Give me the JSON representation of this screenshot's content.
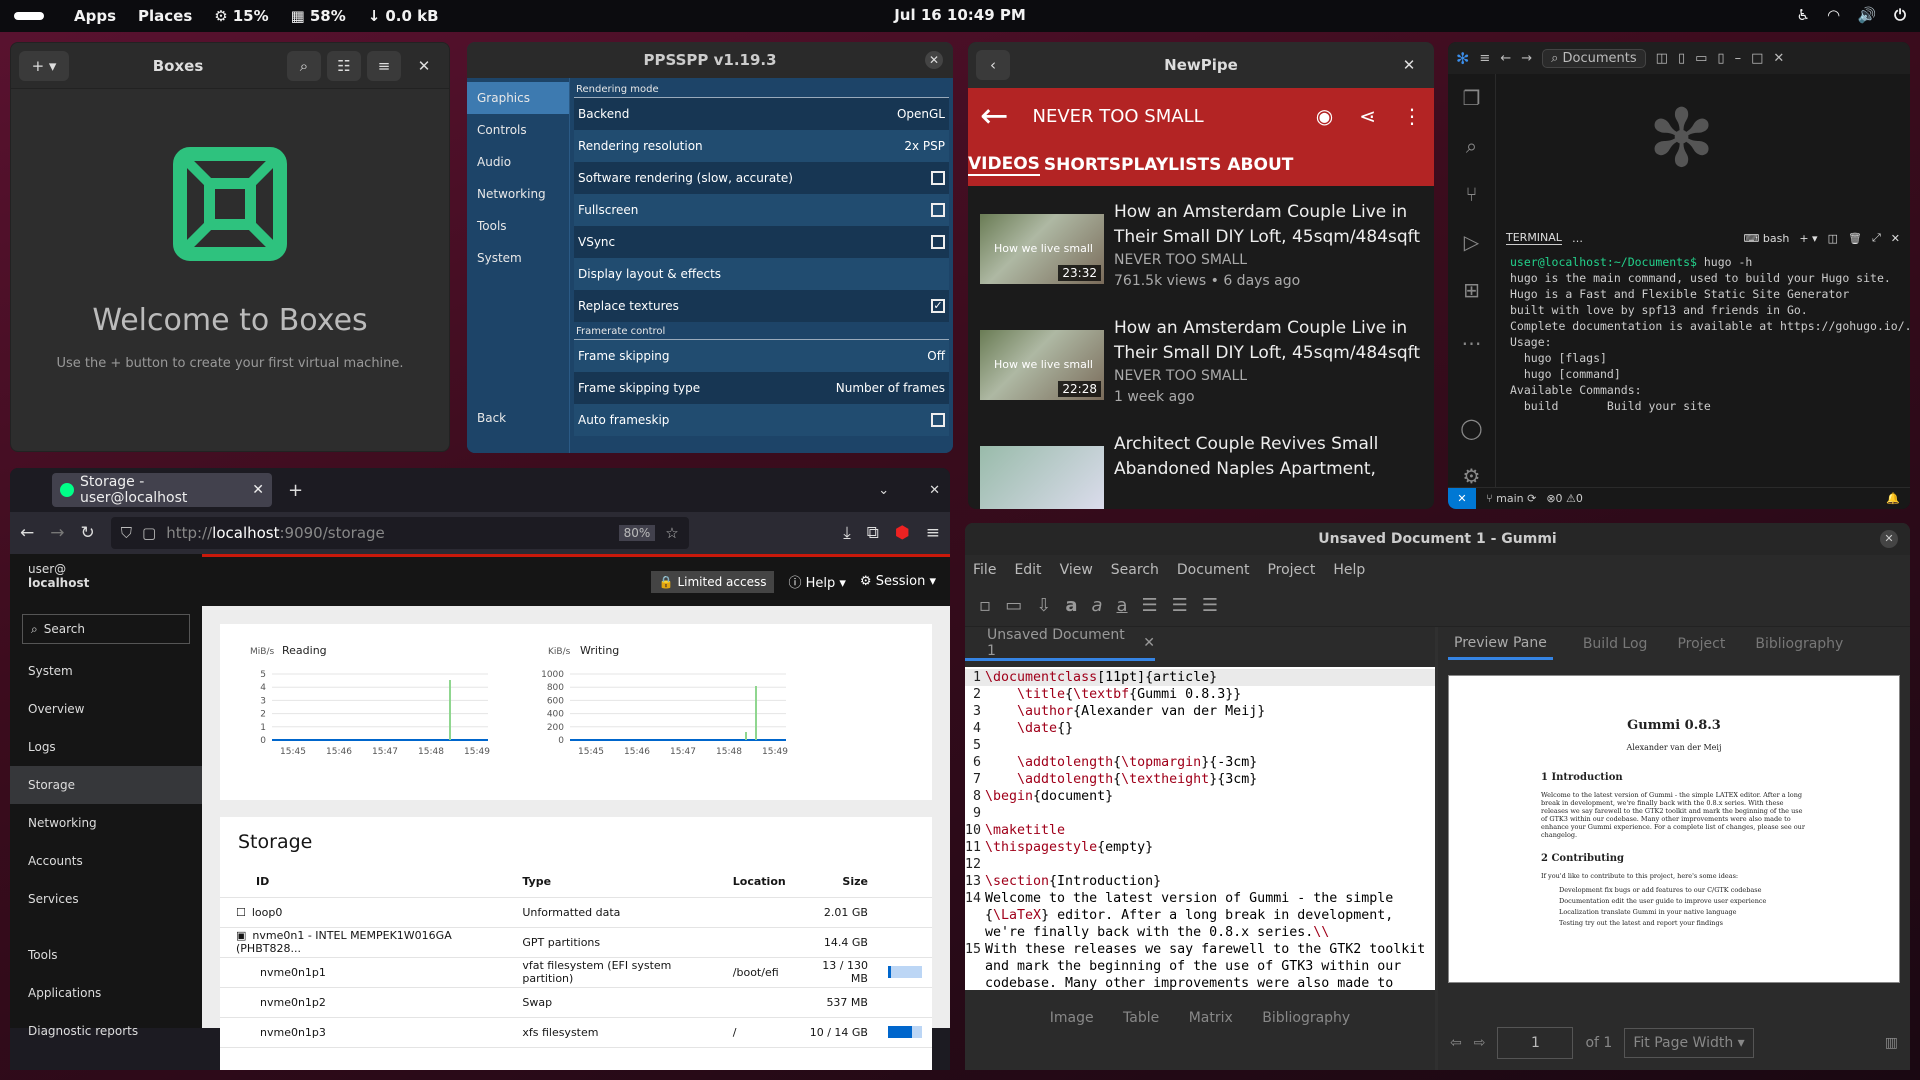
{
  "topbar": {
    "apps": "Apps",
    "places": "Places",
    "cpu": "15%",
    "mem": "58%",
    "net": "0.0 kB",
    "clock": "Jul 16  10:49 PM"
  },
  "boxes": {
    "title": "Boxes",
    "welcome": "Welcome to Boxes",
    "hint": "Use the + button to create your first virtual machine."
  },
  "ppsspp": {
    "title": "PPSSPP v1.19.3",
    "nav": [
      "Graphics",
      "Controls",
      "Audio",
      "Networking",
      "Tools",
      "System"
    ],
    "back": "Back",
    "section1": "Rendering mode",
    "section2": "Framerate control",
    "rows": [
      {
        "label": "Backend",
        "value": "OpenGL"
      },
      {
        "label": "Rendering resolution",
        "value": "2x PSP"
      },
      {
        "label": "Software rendering (slow, accurate)",
        "value": ""
      },
      {
        "label": "Fullscreen",
        "value": ""
      },
      {
        "label": "VSync",
        "value": ""
      },
      {
        "label": "Display layout & effects",
        "value": ""
      },
      {
        "label": "Replace textures",
        "value": ""
      }
    ],
    "rows2": [
      {
        "label": "Frame skipping",
        "value": "Off"
      },
      {
        "label": "Frame skipping type",
        "value": "Number of frames"
      },
      {
        "label": "Auto frameskip",
        "value": ""
      }
    ]
  },
  "newpipe": {
    "title": "NewPipe",
    "channel": "NEVER TOO SMALL",
    "tabs": [
      "VIDEOS",
      "SHORTS",
      "PLAYLISTS",
      "ABOUT"
    ],
    "videos": [
      {
        "title": "How an Amsterdam Couple Live in Their Small DIY Loft, 45sqm/484sqft",
        "channel": "NEVER TOO SMALL",
        "meta": "761.5k views • 6 days ago",
        "duration": "23:32",
        "thumb_text": "How we live small"
      },
      {
        "title": "How an Amsterdam Couple Live in Their Small DIY Loft, 45sqm/484sqft",
        "channel": "NEVER TOO SMALL",
        "meta": "1 week ago",
        "duration": "22:28",
        "thumb_text": "How we live small"
      },
      {
        "title": "Architect Couple Revives Small Abandoned Naples Apartment,",
        "channel": "",
        "meta": "",
        "duration": ""
      }
    ]
  },
  "vscode": {
    "search": "Documents",
    "term_tab": "TERMINAL",
    "shell": "bash",
    "branch": "main",
    "problems": "0",
    "warnings": "0",
    "prompt": "user@localhost:~/Documents$",
    "cmd": " hugo -h",
    "lines": [
      "hugo is the main command, used to build your Hugo site.",
      "",
      "Hugo is a Fast and Flexible Static Site Generator",
      "built with love by spf13 and friends in Go.",
      "",
      "Complete documentation is available at https://gohugo.io/.",
      "",
      "Usage:",
      "  hugo [flags]",
      "  hugo [command]",
      "",
      "Available Commands:",
      "  build       Build your site"
    ]
  },
  "firefox": {
    "tab": "Storage - user@localhost",
    "url_prefix": "http://",
    "url_host": "localhost",
    "url_rest": ":9090/storage",
    "zoom": "80%"
  },
  "cockpit": {
    "user": "user@",
    "host": "localhost",
    "search": "Search",
    "nav": [
      "System",
      "Overview",
      "Logs",
      "Storage",
      "Networking",
      "Accounts",
      "Services",
      "Tools",
      "Applications",
      "Diagnostic reports"
    ],
    "limited": "Limited access",
    "help": "Help",
    "session": "Session",
    "reading": {
      "unit": "MiB/s",
      "label": "Reading",
      "yticks": [
        "5",
        "4",
        "3",
        "2",
        "1",
        "0"
      ]
    },
    "writing": {
      "unit": "KiB/s",
      "label": "Writing",
      "yticks": [
        "1000",
        "800",
        "600",
        "400",
        "200",
        "0"
      ]
    },
    "times": [
      "15:45",
      "15:46",
      "15:47",
      "15:48",
      "15:49"
    ],
    "storage_title": "Storage",
    "cols": [
      "ID",
      "Type",
      "Location",
      "Size"
    ],
    "rows": [
      {
        "id": "loop0",
        "type": "Unformatted data",
        "loc": "",
        "size": "2.01 GB",
        "bar": null
      },
      {
        "id": "nvme0n1 - INTEL MEMPEK1W016GA (PHBT828...",
        "type": "GPT partitions",
        "loc": "",
        "size": "14.4 GB",
        "bar": null
      },
      {
        "id": "nvme0n1p1",
        "type": "vfat filesystem (EFI system partition)",
        "loc": "/boot/efi",
        "size": "13 / 130 MB",
        "bar": 0.1
      },
      {
        "id": "nvme0n1p2",
        "type": "Swap",
        "loc": "",
        "size": "537 MB",
        "bar": null
      },
      {
        "id": "nvme0n1p3",
        "type": "xfs filesystem",
        "loc": "/",
        "size": "10 / 14 GB",
        "bar": 0.71
      }
    ]
  },
  "gummi": {
    "title": "Unsaved Document 1 - Gummi",
    "menu": [
      "File",
      "Edit",
      "View",
      "Search",
      "Document",
      "Project",
      "Help"
    ],
    "tab": "Unsaved Document 1",
    "ptabs": [
      "Preview Pane",
      "Build Log",
      "Project",
      "Bibliography"
    ],
    "bottom": [
      "Image",
      "Table",
      "Matrix",
      "Bibliography"
    ],
    "page": "1",
    "of": "of 1",
    "fit": "Fit Page Width",
    "pdf": {
      "title": "Gummi 0.8.3",
      "author": "Alexander van der Meij",
      "s1": "1   Introduction",
      "p1": "Welcome to the latest version of Gummi - the simple LATEX editor. After a long break in development, we're finally back with the 0.8.x series. With these releases we say farewell to the GTK2 toolkit and mark the beginning of the use of GTK3 within our codebase. Many other improvements were also made to enhance your Gummi experience. For a complete list of changes, please see our changelog.",
      "s2": "2   Contributing",
      "p2": "If you'd like to contribute to this project, here's some ideas:",
      "items": [
        "Development  fix bugs or add features to our C/GTK codebase",
        "Documentation  edit the user guide to improve user experience",
        "Localization  translate Gummi in your native language",
        "Testing  try out the latest and report your findings"
      ]
    }
  }
}
